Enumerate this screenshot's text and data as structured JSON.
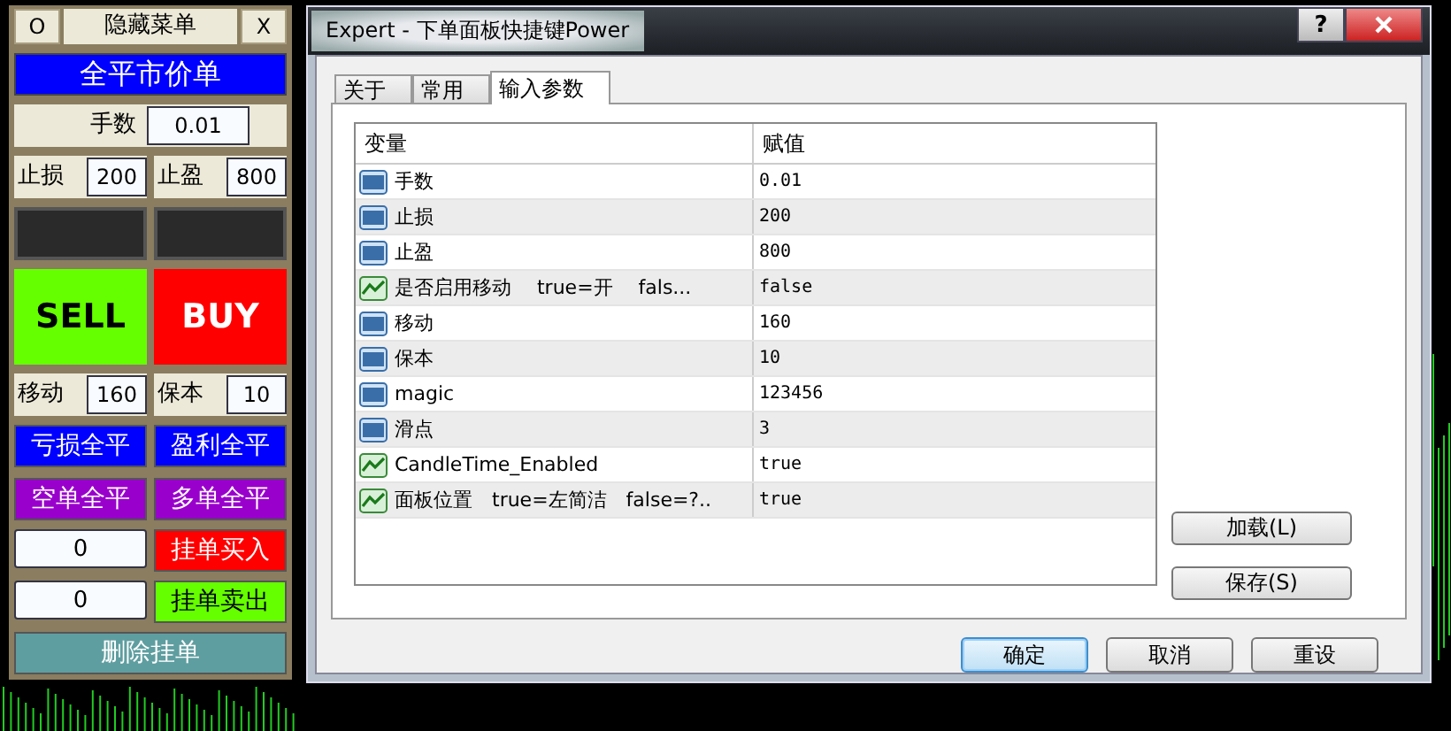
{
  "panel": {
    "hide_button": "O",
    "title": "隐藏菜单",
    "close_button": "X",
    "close_all_button": {
      "label": "全平市价单",
      "color": "#0000ff"
    },
    "lots": {
      "label": "手数",
      "value": "0.01"
    },
    "stop_loss": {
      "label": "止损",
      "value": "200"
    },
    "take_profit": {
      "label": "止盈",
      "value": "800"
    },
    "sell_button": {
      "label": "SELL",
      "color": "#66ff00"
    },
    "buy_button": {
      "label": "BUY",
      "color": "#ff0000"
    },
    "trailing": {
      "label": "移动",
      "value": "160"
    },
    "breakeven": {
      "label": "保本",
      "value": "10"
    },
    "close_buttons": [
      {
        "label": "亏损全平",
        "color": "#0000ff"
      },
      {
        "label": "盈利全平",
        "color": "#0000ff"
      },
      {
        "label": "空单全平",
        "color": "#9900cc"
      },
      {
        "label": "多单全平",
        "color": "#9900cc"
      }
    ],
    "pending": [
      {
        "value": "0",
        "button": "挂单买入",
        "color": "#ff0000"
      },
      {
        "value": "0",
        "button": "挂单卖出",
        "color": "#66ff00"
      }
    ],
    "delete_button": {
      "label": "删除挂单",
      "color": "#5f9ea0"
    }
  },
  "dialog": {
    "title": "Expert - 下单面板快捷键Power",
    "help_button": "?",
    "tabs": [
      {
        "label": "关于",
        "selected": false
      },
      {
        "label": "常用",
        "selected": false
      },
      {
        "label": "输入参数",
        "selected": true
      }
    ],
    "table": {
      "columns": [
        "变量",
        "赋值"
      ],
      "rows": [
        {
          "kind": "double",
          "name": "手数",
          "value": "0.01"
        },
        {
          "kind": "int",
          "name": "止损",
          "value": "200"
        },
        {
          "kind": "int",
          "name": "止盈",
          "value": "800"
        },
        {
          "kind": "bool",
          "name": "是否启用移动　 true=开　 fals...",
          "value": "false"
        },
        {
          "kind": "int",
          "name": "移动",
          "value": "160"
        },
        {
          "kind": "int",
          "name": "保本",
          "value": "10"
        },
        {
          "kind": "int",
          "name": "magic",
          "value": "123456"
        },
        {
          "kind": "int",
          "name": "滑点",
          "value": "3"
        },
        {
          "kind": "bool",
          "name": "CandleTime_Enabled",
          "value": "true"
        },
        {
          "kind": "bool",
          "name": "面板位置　true=左简洁　false=?..",
          "value": "true"
        }
      ]
    },
    "side_buttons": [
      "加载(L)",
      "保存(S)"
    ],
    "footer_buttons": [
      {
        "label": "确定",
        "default": true
      },
      {
        "label": "取消",
        "default": false
      },
      {
        "label": "重设",
        "default": false
      }
    ]
  }
}
